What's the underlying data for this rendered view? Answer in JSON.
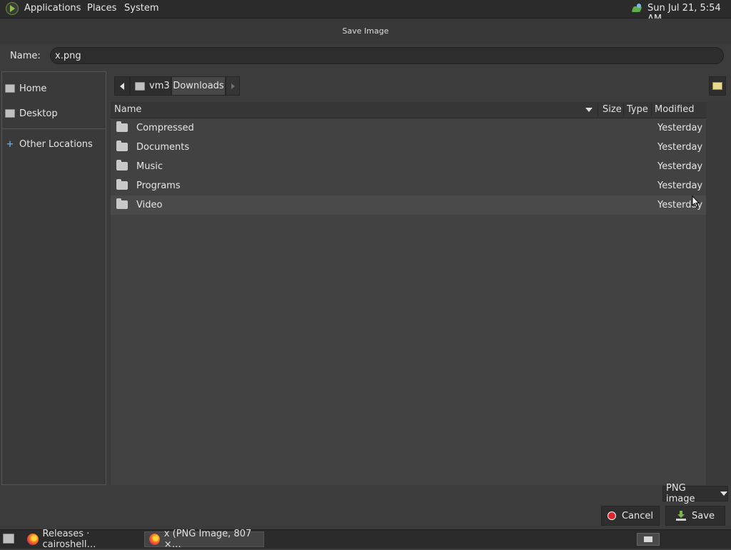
{
  "top_panel": {
    "menus": [
      "Applications",
      "Places",
      "System"
    ],
    "clock": "Sun Jul 21,  5:54 AM"
  },
  "dialog": {
    "title": "Save Image",
    "name_label": "Name:",
    "name_value": "x.png"
  },
  "sidebar": {
    "items": [
      {
        "label": "Home",
        "icon": "drive-icon"
      },
      {
        "label": "Desktop",
        "icon": "drive-icon"
      },
      {
        "label": "Other Locations",
        "icon": "plus-icon"
      }
    ]
  },
  "pathbar": {
    "crumbs": [
      "vm3",
      "Downloads"
    ]
  },
  "filelist": {
    "columns": [
      "Name",
      "Size",
      "Type",
      "Modified"
    ],
    "rows": [
      {
        "name": "Compressed",
        "modified": "Yesterday"
      },
      {
        "name": "Documents",
        "modified": "Yesterday"
      },
      {
        "name": "Music",
        "modified": "Yesterday"
      },
      {
        "name": "Programs",
        "modified": "Yesterday"
      },
      {
        "name": "Video",
        "modified": "Yesterday"
      }
    ]
  },
  "controls": {
    "filter": "PNG image",
    "cancel": "Cancel",
    "save": "Save"
  },
  "taskbar": {
    "tasks": [
      "Releases · cairoshell…",
      "x (PNG Image, 807 ×…"
    ]
  },
  "colors": {
    "panel": "#2b2b2b",
    "dialog_bg": "#3c3c3c",
    "list_bg": "#424242",
    "hover_row": "#4a4a4a",
    "cancel_red": "#e0262d",
    "save_green": "#7ab648"
  }
}
